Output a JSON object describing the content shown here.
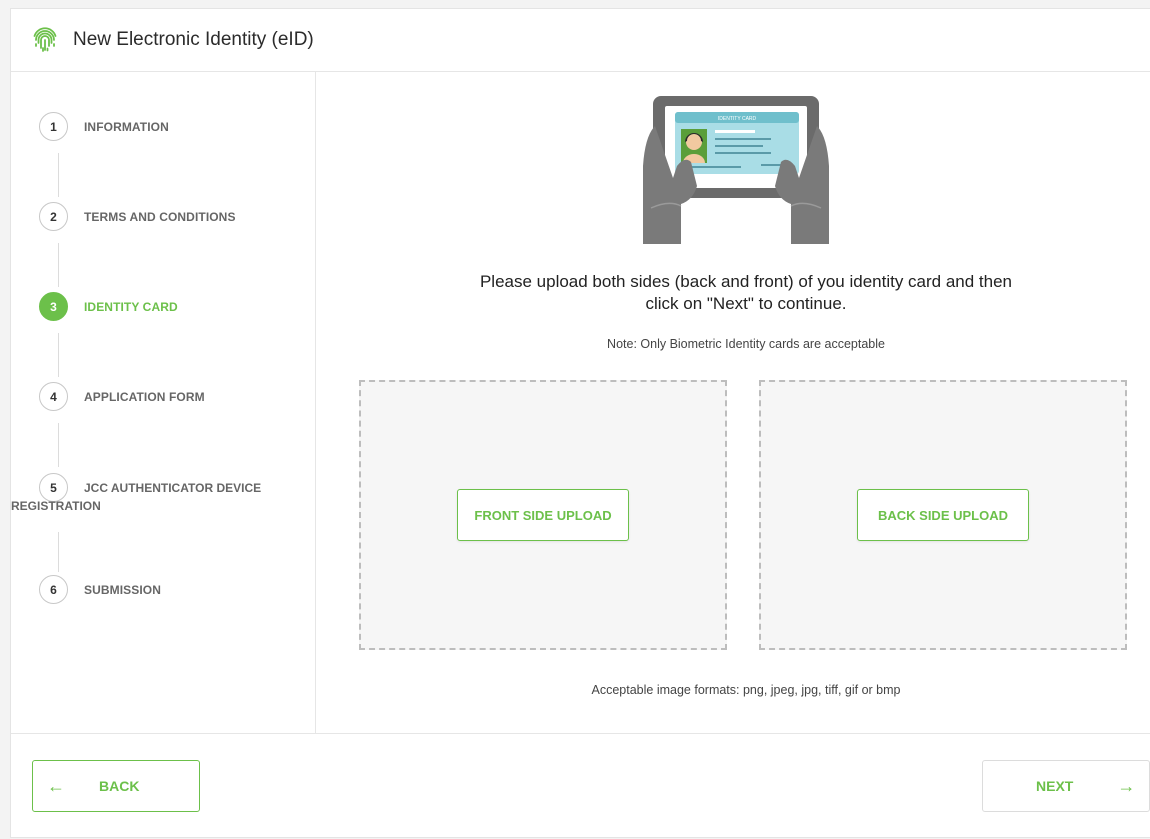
{
  "header": {
    "title": "New Electronic Identity (eID)",
    "icon": "fingerprint-icon"
  },
  "steps": [
    {
      "num": "1",
      "label": "INFORMATION",
      "active": false
    },
    {
      "num": "2",
      "label": "TERMS AND CONDITIONS",
      "active": false
    },
    {
      "num": "3",
      "label": "IDENTITY CARD",
      "active": true
    },
    {
      "num": "4",
      "label": "APPLICATION FORM",
      "active": false
    },
    {
      "num": "5",
      "label_line1": "JCC AUTHENTICATOR DEVICE",
      "label_line2": "REGISTRATION",
      "active": false
    },
    {
      "num": "6",
      "label": "SUBMISSION",
      "active": false
    }
  ],
  "main": {
    "illustration_card_text": "IDENTITY CARD",
    "prompt_line1": "Please upload both sides (back and front) of you identity card and then",
    "prompt_line2": "click on \"Next\" to continue.",
    "note": "Note: Only Biometric Identity cards are acceptable",
    "front_button": "FRONT SIDE UPLOAD",
    "back_button": "BACK SIDE UPLOAD",
    "formats": "Acceptable image formats: png, jpeg, jpg, tiff, gif or bmp"
  },
  "footer": {
    "back_label": "BACK",
    "next_label": "NEXT",
    "back_arrow": "←",
    "next_arrow": "→"
  },
  "colors": {
    "accent": "#6cc04a",
    "border": "#e6e6e6",
    "dropzone_bg": "#f6f6f6"
  }
}
